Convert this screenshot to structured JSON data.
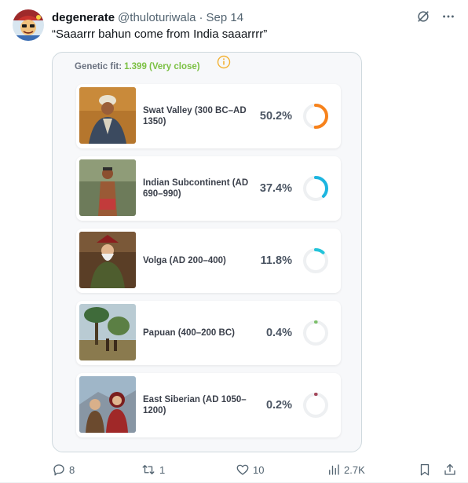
{
  "tweet": {
    "display_name": "degenerate",
    "handle": "@thuloturiwala",
    "separator": "·",
    "timestamp": "Sep 14",
    "text": "“Saaarrr bahun come from India saaarrrr”"
  },
  "icons": {
    "grok": "grok-icon",
    "more": "more-icon",
    "info": "info-icon",
    "reply": "reply-icon",
    "retweet": "retweet-icon",
    "like": "like-icon",
    "views": "views-icon",
    "bookmark": "bookmark-icon",
    "share": "share-icon"
  },
  "media": {
    "fit_label": "Genetic fit:",
    "fit_value": "1.399 (Very close)",
    "fit_color": "#7bc043",
    "populations": [
      {
        "name": "Swat Valley (300 BC–AD 1350)",
        "percent_label": "50.2%",
        "fraction": 0.502,
        "color": "#f7821b"
      },
      {
        "name": "Indian Subcontinent (AD 690–990)",
        "percent_label": "37.4%",
        "fraction": 0.374,
        "color": "#1cb5e0"
      },
      {
        "name": "Volga (AD 200–400)",
        "percent_label": "11.8%",
        "fraction": 0.118,
        "color": "#22c3d9"
      },
      {
        "name": "Papuan (400–200 BC)",
        "percent_label": "0.4%",
        "fraction": 0.004,
        "color": "#7cbf6a"
      },
      {
        "name": "East Siberian (AD 1050–1200)",
        "percent_label": "0.2%",
        "fraction": 0.002,
        "color": "#a3475a"
      }
    ]
  },
  "stats": {
    "replies": "8",
    "retweets": "1",
    "likes": "10",
    "views": "2.7K"
  }
}
